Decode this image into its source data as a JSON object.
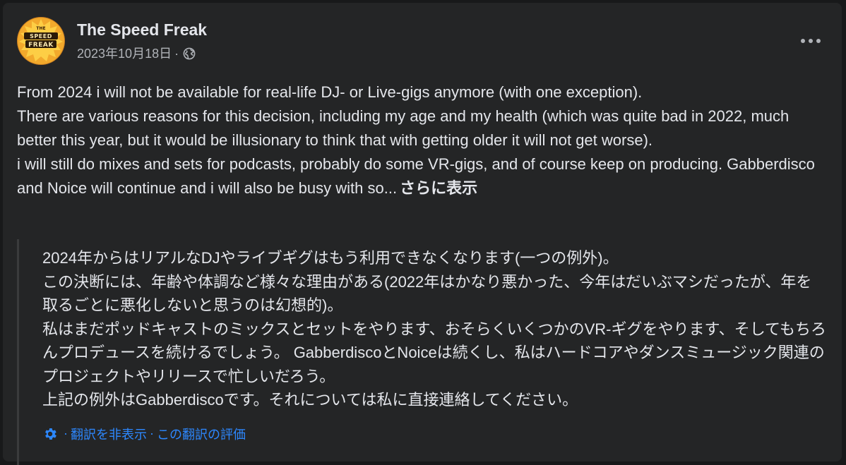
{
  "post": {
    "author": "The Speed Freak",
    "avatar_icon": "speed-freak-logo",
    "date": "2023年10月18日",
    "separator": "·",
    "audience_icon": "globe-icon",
    "more_icon": "more-options-icon",
    "lines": [
      "From 2024 i will not be available for real-life DJ- or Live-gigs anymore (with one exception).",
      "There are various reasons for this decision, including my age and my health (which was quite bad in 2022, much better this year, but it would be illusionary to think that with getting older it will not get worse).",
      "i will still do mixes and sets for podcasts, probably do some VR-gigs, and of course keep on producing. Gabberdisco and Noice will continue and i will also be busy with so..."
    ],
    "see_more_label": "さらに表示"
  },
  "translation": {
    "lines": [
      "2024年からはリアルなDJやライブギグはもう利用できなくなります(一つの例外)。",
      "この決断には、年齢や体調など様々な理由がある(2022年はかなり悪かった、今年はだいぶマシだったが、年を取るごとに悪化しないと思うのは幻想的)。",
      "私はまだポッドキャストのミックスとセットをやります、おそらくいくつかのVR-ギグをやります、そしてもちろんプロデュースを続けるでしょう。 GabberdiscoとNoiceは続くし、私はハードコアやダンスミュージック関連のプロジェクトやリリースで忙しいだろう。",
      "上記の例外はGabberdiscoです。それについては私に直接連絡してください。"
    ],
    "settings_icon": "gear-icon",
    "separator": "·",
    "hide_label": "翻訳を非表示",
    "rate_label": "この翻訳の評価"
  },
  "colors": {
    "background": "#18191a",
    "card": "#242526",
    "text": "#e4e6eb",
    "secondary_text": "#b0b3b8",
    "link": "#2d88ff"
  }
}
